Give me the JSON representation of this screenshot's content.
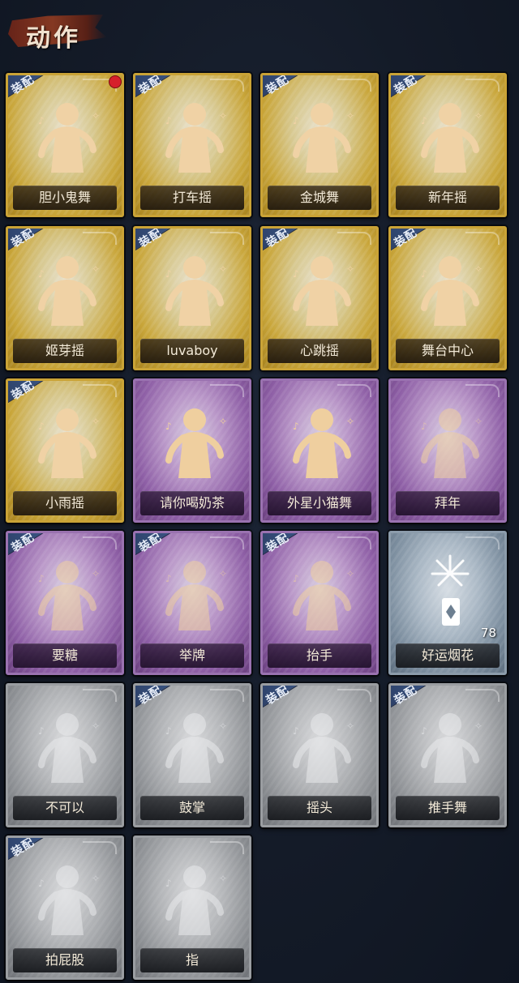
{
  "header": {
    "title": "动作"
  },
  "badge_label": "装配",
  "colors": {
    "gold": "#caa336",
    "purple": "#9a72b0",
    "blue": "#8c9cab",
    "gray": "#9a9da1",
    "badge": "#2c3f66",
    "notify": "#d6202b"
  },
  "cards": [
    {
      "name": "胆小鬼舞",
      "rarity": "gold",
      "equipped": true,
      "notify": true,
      "icon": "timid-dance-icon"
    },
    {
      "name": "打车摇",
      "rarity": "gold",
      "equipped": true,
      "icon": "taxi-shake-icon"
    },
    {
      "name": "金城舞",
      "rarity": "gold",
      "equipped": true,
      "icon": "golden-city-dance-icon"
    },
    {
      "name": "新年摇",
      "rarity": "gold",
      "equipped": true,
      "icon": "new-year-shake-icon"
    },
    {
      "name": "姬芽摇",
      "rarity": "gold",
      "equipped": true,
      "icon": "sprout-shake-icon"
    },
    {
      "name": "luvaboy",
      "rarity": "gold",
      "equipped": true,
      "icon": "luvaboy-icon"
    },
    {
      "name": "心跳摇",
      "rarity": "gold",
      "equipped": true,
      "icon": "heartbeat-shake-icon"
    },
    {
      "name": "舞台中心",
      "rarity": "gold",
      "equipped": true,
      "icon": "center-stage-icon"
    },
    {
      "name": "小雨摇",
      "rarity": "gold",
      "equipped": true,
      "icon": "light-rain-shake-icon"
    },
    {
      "name": "请你喝奶茶",
      "rarity": "purple",
      "equipped": false,
      "icon": "milk-tea-icon"
    },
    {
      "name": "外星小猫舞",
      "rarity": "purple",
      "equipped": false,
      "icon": "alien-cat-dance-icon"
    },
    {
      "name": "拜年",
      "rarity": "purple",
      "equipped": false,
      "icon": "new-year-greeting-icon"
    },
    {
      "name": "要糖",
      "rarity": "purple",
      "equipped": true,
      "icon": "ask-candy-icon"
    },
    {
      "name": "举牌",
      "rarity": "purple",
      "equipped": true,
      "icon": "hold-sign-icon"
    },
    {
      "name": "抬手",
      "rarity": "purple",
      "equipped": true,
      "icon": "raise-hand-icon"
    },
    {
      "name": "好运烟花",
      "rarity": "blue",
      "equipped": false,
      "count": "78",
      "icon": "firework-icon"
    },
    {
      "name": "不可以",
      "rarity": "gray",
      "equipped": false,
      "icon": "finger-wag-icon"
    },
    {
      "name": "鼓掌",
      "rarity": "gray",
      "equipped": true,
      "icon": "clap-icon"
    },
    {
      "name": "摇头",
      "rarity": "gray",
      "equipped": true,
      "icon": "head-shake-icon"
    },
    {
      "name": "推手舞",
      "rarity": "gray",
      "equipped": true,
      "icon": "push-hand-dance-icon"
    },
    {
      "name": "拍屁股",
      "rarity": "gray",
      "equipped": true,
      "icon": "butt-slap-icon"
    },
    {
      "name": "指",
      "rarity": "gray",
      "equipped": false,
      "icon": "point-icon"
    }
  ]
}
